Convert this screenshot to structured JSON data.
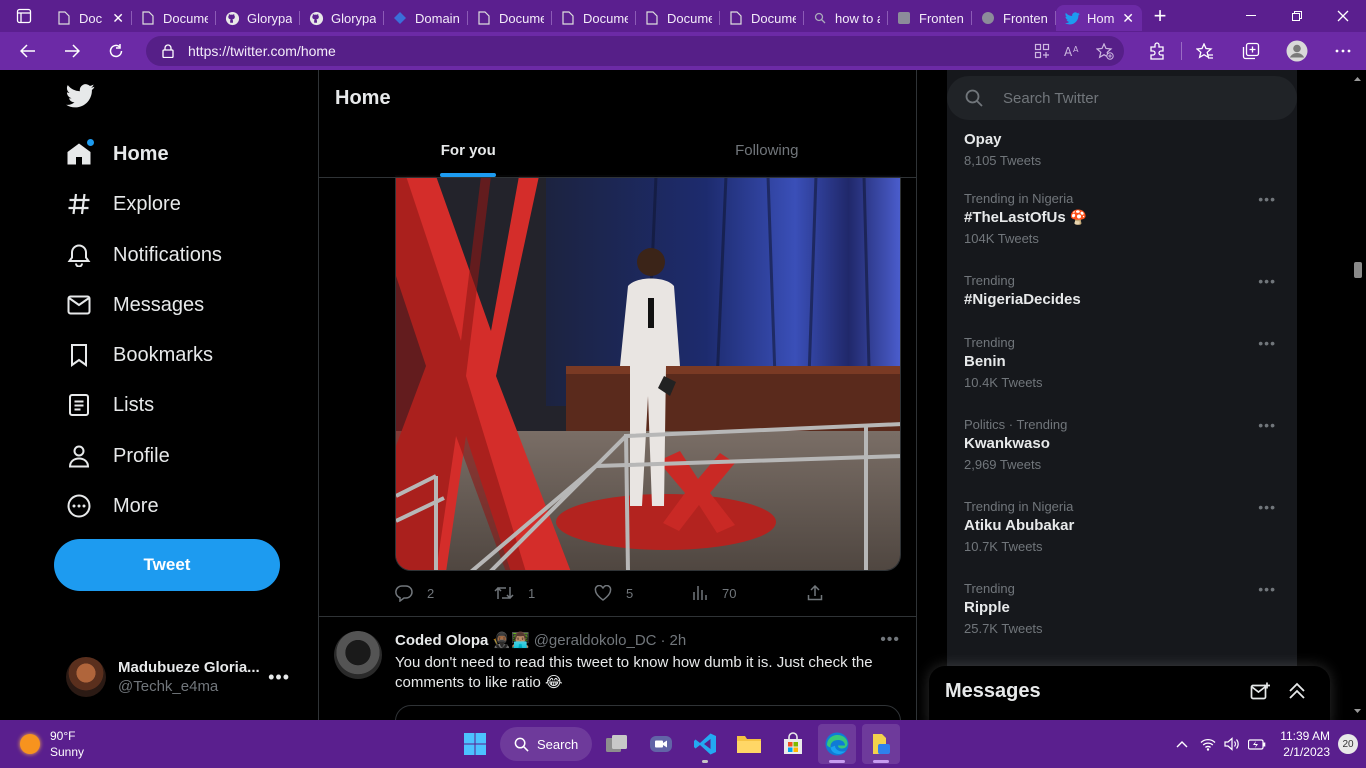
{
  "browser": {
    "tabs": [
      {
        "label": "Doc",
        "icon": "doc-icon"
      },
      {
        "label": "Documen",
        "icon": "doc-icon"
      },
      {
        "label": "Glorypau",
        "icon": "github-icon"
      },
      {
        "label": "Glorypau",
        "icon": "github-icon"
      },
      {
        "label": "Domain r",
        "icon": "domain-icon"
      },
      {
        "label": "Documen",
        "icon": "doc-icon"
      },
      {
        "label": "Documen",
        "icon": "doc-icon"
      },
      {
        "label": "Documen",
        "icon": "doc-icon"
      },
      {
        "label": "Documen",
        "icon": "doc-icon"
      },
      {
        "label": "how to a",
        "icon": "search-icon"
      },
      {
        "label": "Frontend",
        "icon": "frontend-icon"
      },
      {
        "label": "Frontend",
        "icon": "frontend-icon"
      },
      {
        "label": "Hom",
        "icon": "twitter-icon"
      }
    ],
    "url": "https://twitter.com/home",
    "accent": "#6c2aa6"
  },
  "sidebar": {
    "items": [
      {
        "label": "Home",
        "icon": "home-icon"
      },
      {
        "label": "Explore",
        "icon": "hashtag-icon"
      },
      {
        "label": "Notifications",
        "icon": "bell-icon"
      },
      {
        "label": "Messages",
        "icon": "mail-icon"
      },
      {
        "label": "Bookmarks",
        "icon": "bookmark-icon"
      },
      {
        "label": "Lists",
        "icon": "list-icon"
      },
      {
        "label": "Profile",
        "icon": "person-icon"
      },
      {
        "label": "More",
        "icon": "more-circle-icon"
      }
    ],
    "tweet_button": "Tweet",
    "account": {
      "name": "Madubueze Gloria...",
      "handle": "@Techk_e4ma"
    }
  },
  "main": {
    "title": "Home",
    "tabs": [
      "For you",
      "Following"
    ],
    "post1": {
      "replies": "2",
      "retweets": "1",
      "likes": "5",
      "views": "70"
    },
    "post2": {
      "name": "Coded Olopa",
      "emoji": "🥷🏾👨🏽‍💻",
      "handle": "@geraldokolo_DC",
      "sep": "·",
      "time": "2h",
      "text": "You don't need to read this tweet to know how dumb it is. Just check the comments to like ratio 😂"
    }
  },
  "right": {
    "search_placeholder": "Search Twitter",
    "trends": [
      {
        "meta": "",
        "name": "Opay",
        "count": "8,105 Tweets"
      },
      {
        "meta": "Trending in Nigeria",
        "name": "#TheLastOfUs",
        "count": "104K Tweets"
      },
      {
        "meta": "Trending",
        "name": "#NigeriaDecides",
        "count": ""
      },
      {
        "meta": "Trending",
        "name": "Benin",
        "count": "10.4K Tweets"
      },
      {
        "meta": "Politics · Trending",
        "name": "Kwankwaso",
        "count": "2,969 Tweets"
      },
      {
        "meta": "Trending in Nigeria",
        "name": "Atiku Abubakar",
        "count": "10.7K Tweets"
      },
      {
        "meta": "Trending",
        "name": "Ripple",
        "count": "25.7K Tweets"
      }
    ],
    "messages_title": "Messages"
  },
  "taskbar": {
    "weather_temp": "90°F",
    "weather_desc": "Sunny",
    "search_label": "Search",
    "time": "11:39 AM",
    "date": "2/1/2023",
    "notif_count": "20"
  },
  "colors": {
    "twitter_blue": "#1d9bf0",
    "taskbar": "#5a1f8e"
  }
}
